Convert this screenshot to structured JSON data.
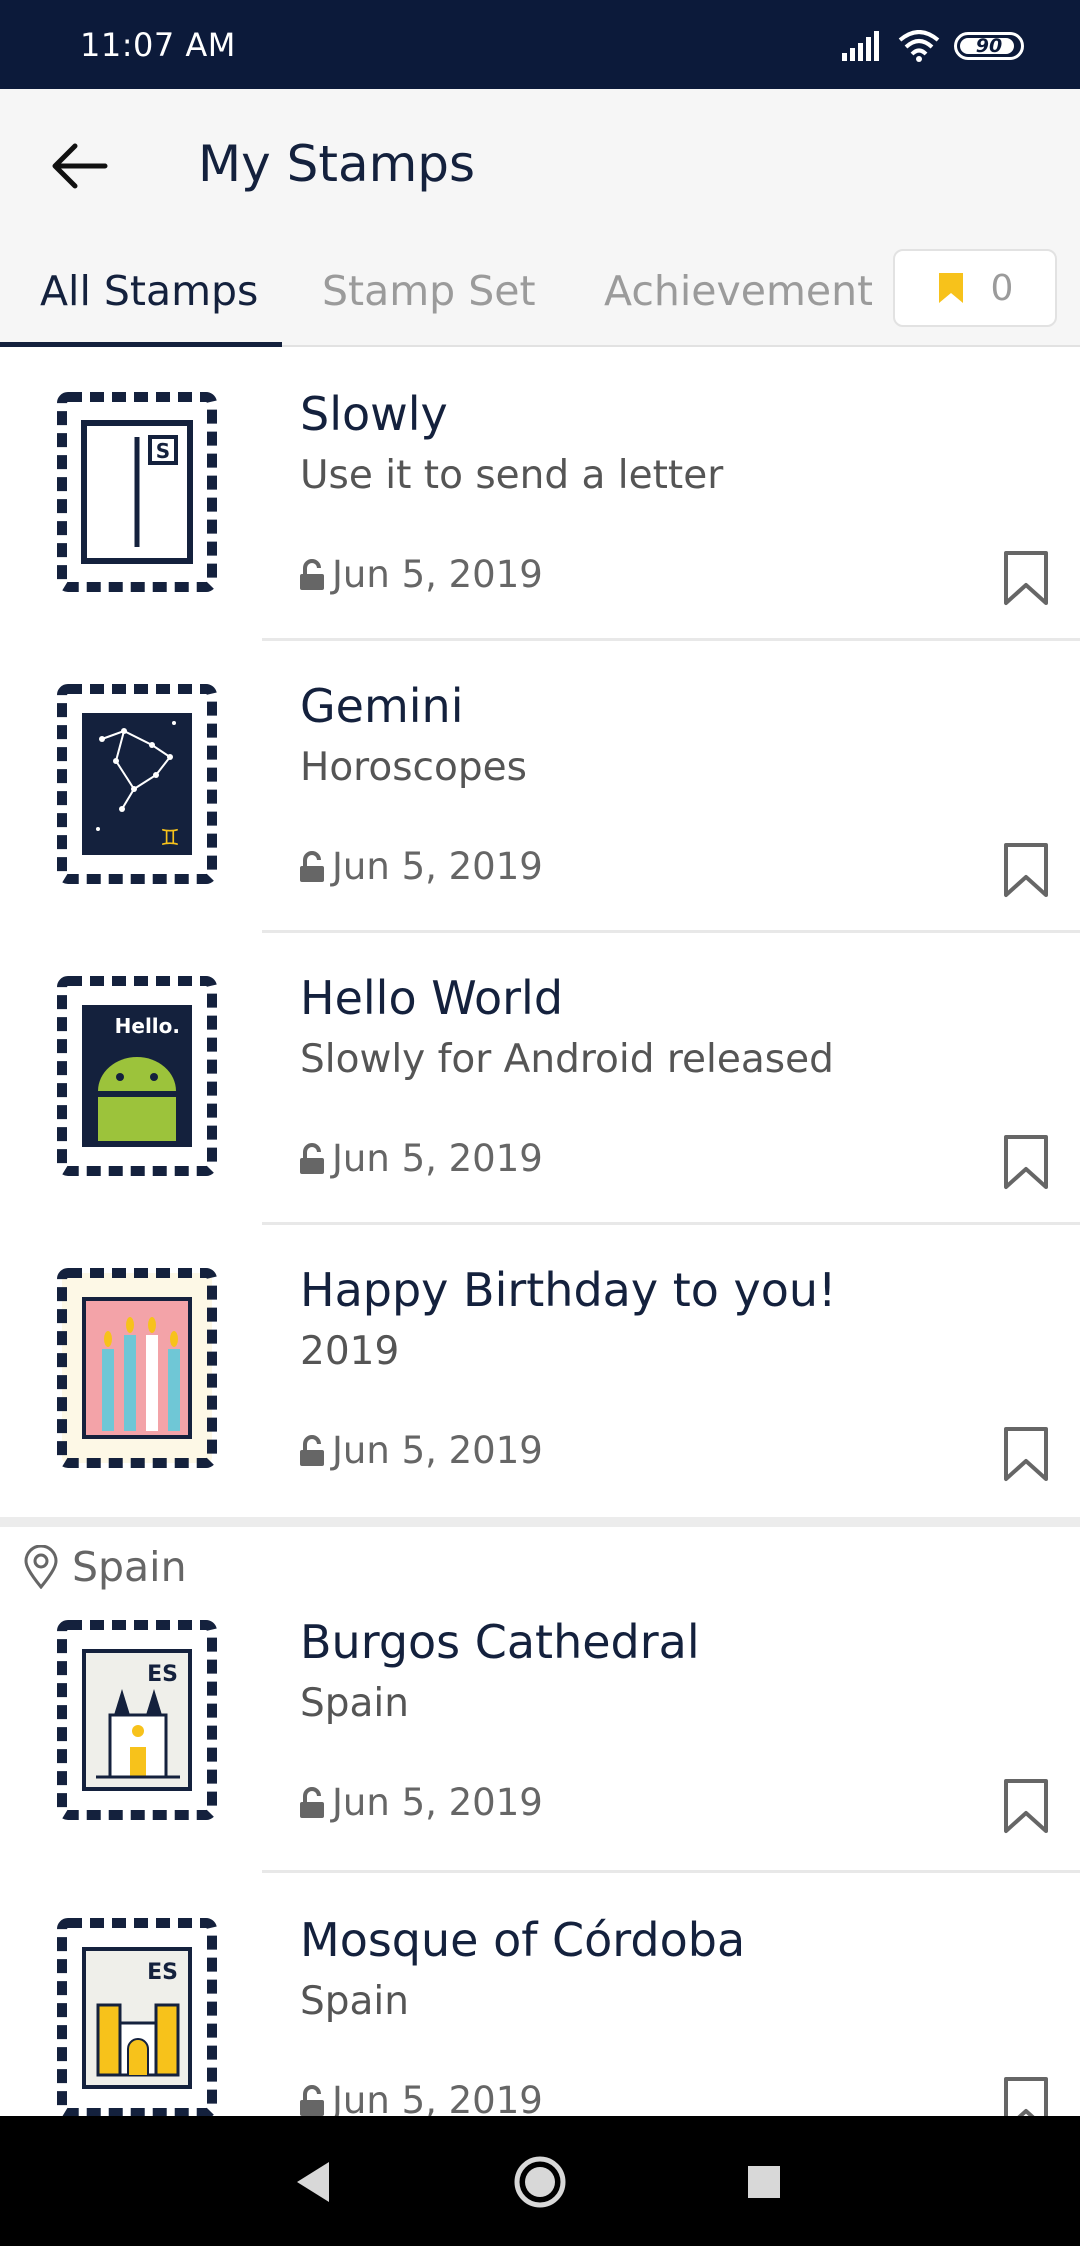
{
  "status_bar": {
    "time": "11:07 AM",
    "battery": "90"
  },
  "header": {
    "title": "My Stamps"
  },
  "tabs": [
    {
      "label": "All Stamps",
      "active": true
    },
    {
      "label": "Stamp Set",
      "active": false
    },
    {
      "label": "Achievements",
      "active": false
    }
  ],
  "bookmark_count": "0",
  "stamps": [
    {
      "name": "Slowly",
      "description": "Use it to send a letter",
      "date": "Jun 5, 2019"
    },
    {
      "name": "Gemini",
      "description": "Horoscopes",
      "date": "Jun 5, 2019"
    },
    {
      "name": "Hello World",
      "description": "Slowly for Android released",
      "date": "Jun 5, 2019",
      "stamp_text": "Hello."
    },
    {
      "name": "Happy Birthday to you!",
      "description": "2019",
      "date": "Jun 5, 2019"
    }
  ],
  "location_section": {
    "label": "Spain",
    "stamps": [
      {
        "name": "Burgos Cathedral",
        "description": "Spain",
        "date": "Jun 5, 2019",
        "stamp_text": "ES"
      },
      {
        "name": "Mosque of Córdoba",
        "description": "Spain",
        "date": "Jun 5, 2019",
        "stamp_text": "ES"
      }
    ]
  },
  "colors": {
    "navy": "#14213d",
    "status_bar": "#0c1a3a",
    "accent_yellow": "#f7c21b",
    "android_green": "#9cc33b"
  },
  "icons": {
    "back": "arrow-left-icon",
    "bookmark": "bookmark-icon",
    "lock": "unlock-icon",
    "location": "location-pin-icon"
  }
}
